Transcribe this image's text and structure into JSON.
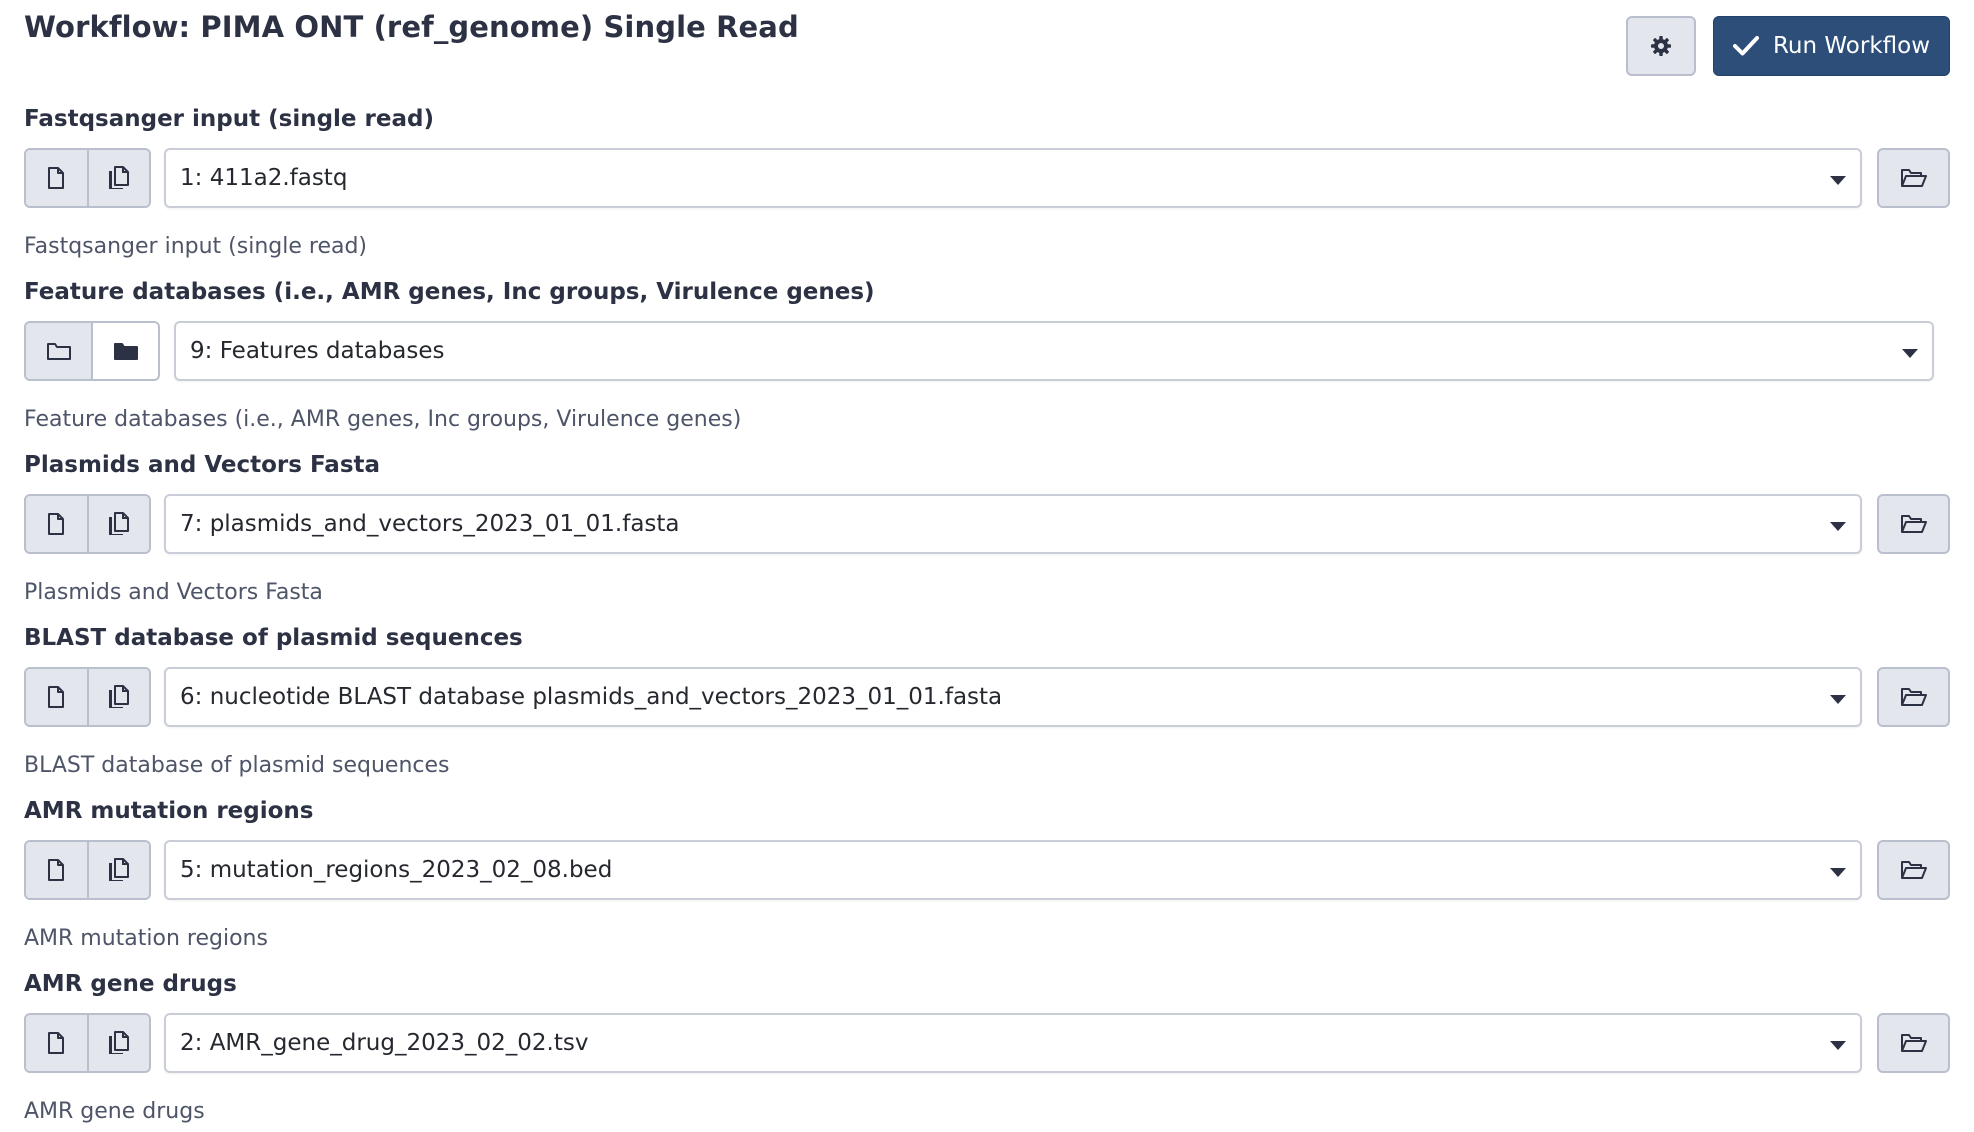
{
  "header": {
    "title": "Workflow: PIMA ONT (ref_genome) Single Read",
    "settings_icon": "gear-icon",
    "run_label": "Run Workflow",
    "run_icon": "check-icon"
  },
  "colors": {
    "primary": "#2c4e79",
    "button_bg": "#e3e6ec",
    "border": "#b9bfcc",
    "text": "#2c3143"
  },
  "fields": [
    {
      "label": "Fastqsanger input (single read)",
      "value": "1: 411a2.fastq",
      "help": "Fastqsanger input (single read)",
      "mode_icons": [
        "file-icon",
        "files-icon"
      ],
      "has_browse": true
    },
    {
      "label": "Feature databases (i.e., AMR genes, Inc groups, Virulence genes)",
      "value": "9: Features databases",
      "help": "Feature databases (i.e., AMR genes, Inc groups, Virulence genes)",
      "mode_icons": [
        "folder-icon",
        "folder-filled-icon"
      ],
      "has_browse": false
    },
    {
      "label": "Plasmids and Vectors Fasta",
      "value": "7: plasmids_and_vectors_2023_01_01.fasta",
      "help": "Plasmids and Vectors Fasta",
      "mode_icons": [
        "file-icon",
        "files-icon"
      ],
      "has_browse": true
    },
    {
      "label": "BLAST database of plasmid sequences",
      "value": "6: nucleotide BLAST database plasmids_and_vectors_2023_01_01.fasta",
      "help": "BLAST database of plasmid sequences",
      "mode_icons": [
        "file-icon",
        "files-icon"
      ],
      "has_browse": true
    },
    {
      "label": "AMR mutation regions",
      "value": "5: mutation_regions_2023_02_08.bed",
      "help": "AMR mutation regions",
      "mode_icons": [
        "file-icon",
        "files-icon"
      ],
      "has_browse": true
    },
    {
      "label": "AMR gene drugs",
      "value": "2: AMR_gene_drug_2023_02_02.tsv",
      "help": "AMR gene drugs",
      "mode_icons": [
        "file-icon",
        "files-icon"
      ],
      "has_browse": true
    }
  ]
}
